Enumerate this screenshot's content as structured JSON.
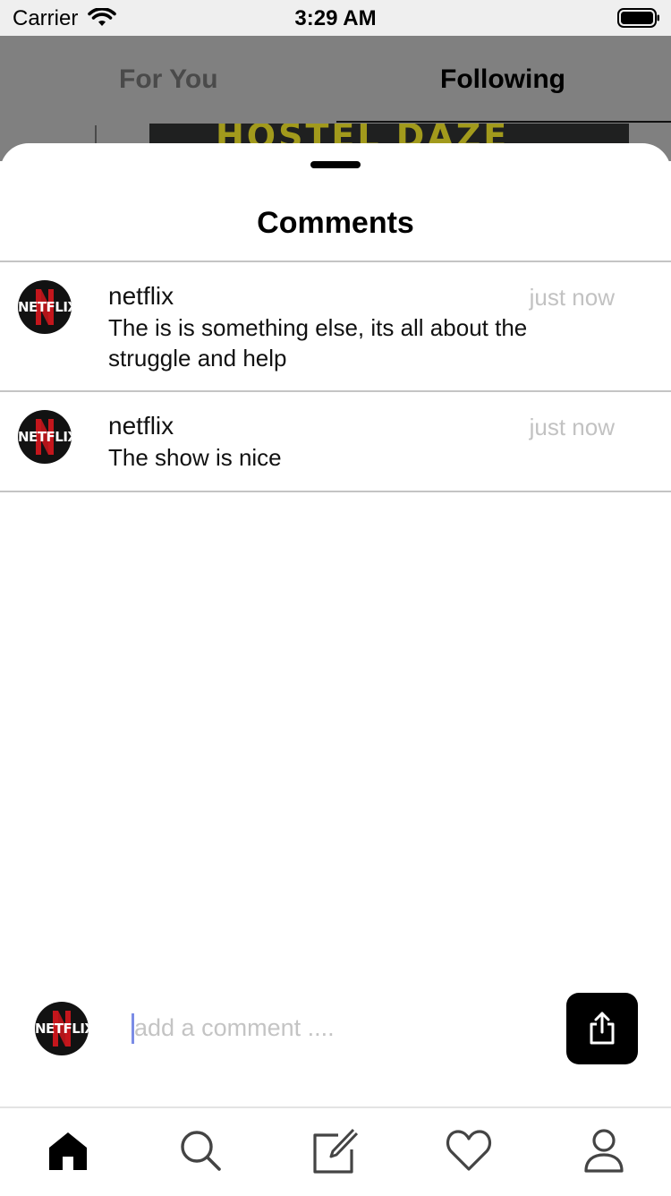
{
  "status_bar": {
    "carrier": "Carrier",
    "time": "3:29 AM",
    "icons": [
      "wifi-icon",
      "battery-icon"
    ]
  },
  "feed": {
    "tabs": [
      {
        "label": "For You",
        "active": false
      },
      {
        "label": "Following",
        "active": true
      }
    ],
    "poster_title": "HOSTEL DAZE"
  },
  "sheet": {
    "title": "Comments"
  },
  "comments": [
    {
      "avatar_text": "NETFLIX",
      "username": "netflix",
      "timestamp": "just now",
      "text": "The is is  something else, its all about the struggle and help"
    },
    {
      "avatar_text": "NETFLIX",
      "username": "netflix",
      "timestamp": "just now",
      "text": "The show is nice"
    }
  ],
  "composer": {
    "avatar_text": "NETFLIX",
    "placeholder": "add a comment ....",
    "value": "",
    "send_icon": "share-upload-icon"
  },
  "tab_bar": {
    "icons": [
      "home-icon",
      "search-icon",
      "compose-icon",
      "heart-icon",
      "profile-icon"
    ]
  },
  "colors": {
    "accent": "#000000",
    "overlay": "#808080",
    "muted_text": "#c2c2c2",
    "netflix_red": "#c4161c",
    "caret": "#7b8ce6"
  }
}
